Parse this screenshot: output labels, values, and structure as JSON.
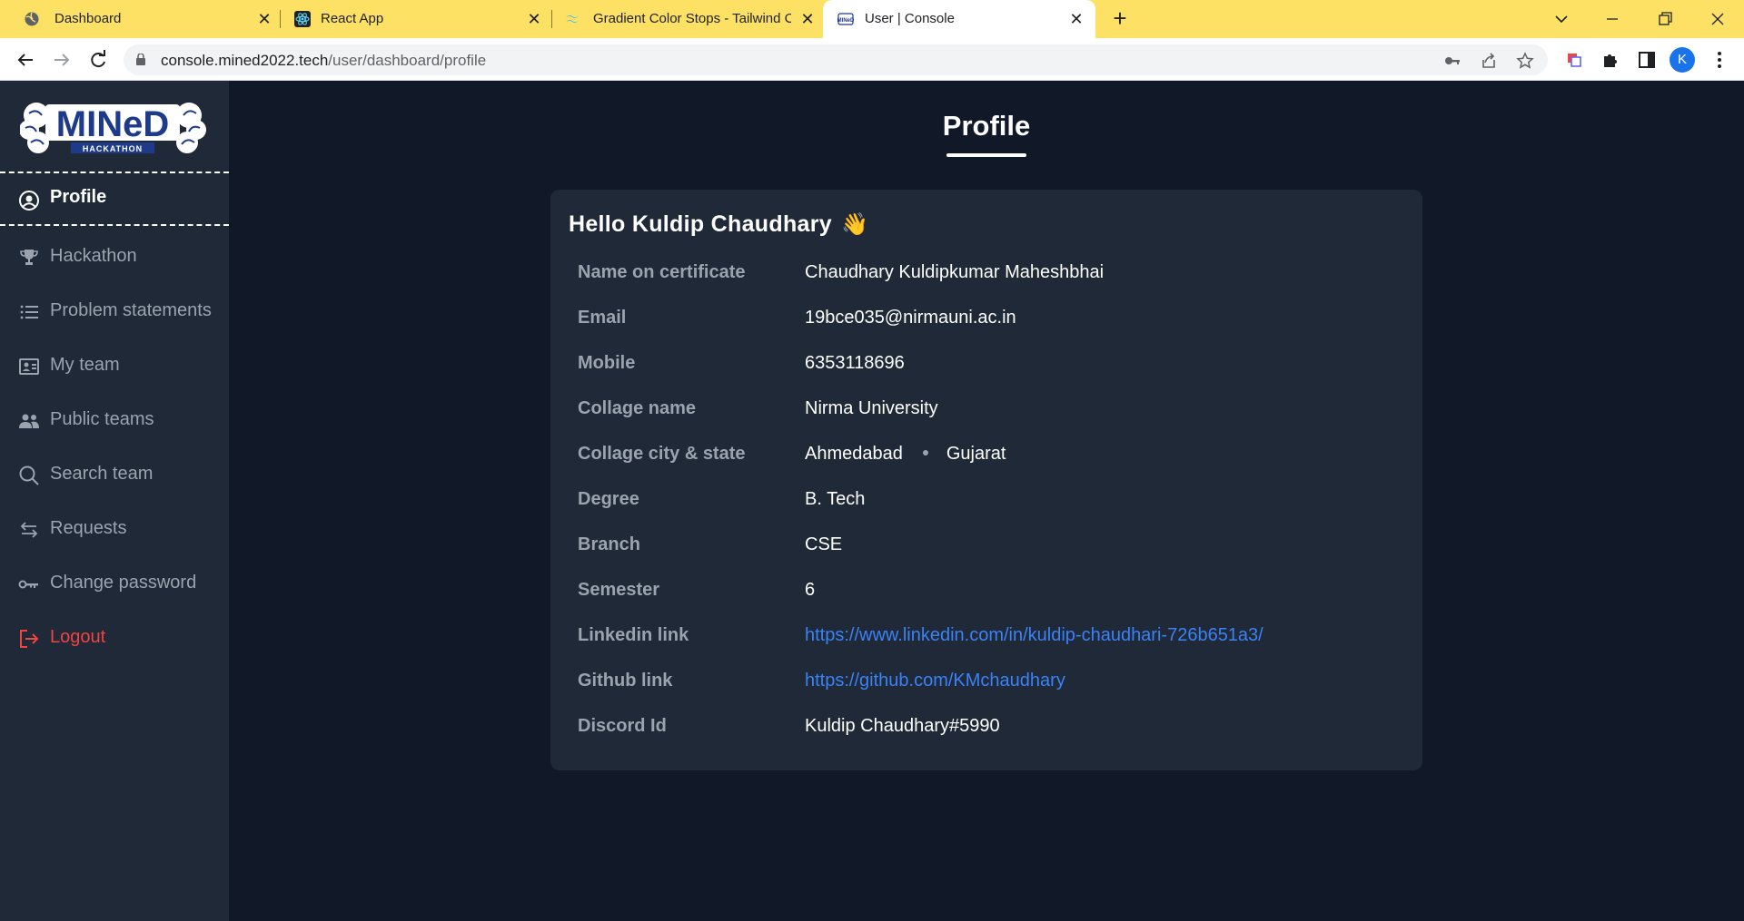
{
  "browser": {
    "tabs": [
      {
        "title": "Dashboard",
        "icon": "globe-icon"
      },
      {
        "title": "React App",
        "icon": "react-icon"
      },
      {
        "title": "Gradient Color Stops - Tailwind C",
        "icon": "tailwind-icon"
      },
      {
        "title": "User | Console",
        "icon": "mined-icon",
        "active": true
      }
    ],
    "url_host": "console.mined2022.tech",
    "url_path": "/user/dashboard/profile",
    "profile_initial": "K"
  },
  "sidebar": {
    "logo_alt": "MINeD HACKATHON",
    "logo_text": "MINeD",
    "logo_sub": "HACKATHON",
    "items": [
      {
        "label": "Profile",
        "icon": "user-circle-icon"
      },
      {
        "label": "Hackathon",
        "icon": "trophy-icon"
      },
      {
        "label": "Problem statements",
        "icon": "list-icon"
      },
      {
        "label": "My team",
        "icon": "id-card-icon"
      },
      {
        "label": "Public teams",
        "icon": "users-icon"
      },
      {
        "label": "Search team",
        "icon": "search-icon"
      },
      {
        "label": "Requests",
        "icon": "arrows-swap-icon"
      },
      {
        "label": "Change password",
        "icon": "key-icon"
      },
      {
        "label": "Logout",
        "icon": "logout-icon"
      }
    ]
  },
  "main": {
    "title": "Profile",
    "greeting": "Hello Kuldip Chaudhary",
    "greeting_emoji": "👋",
    "fields": [
      {
        "label": "Name on certificate",
        "value": "Chaudhary Kuldipkumar Maheshbhai"
      },
      {
        "label": "Email",
        "value": "19bce035@nirmauni.ac.in"
      },
      {
        "label": "Mobile",
        "value": "6353118696"
      },
      {
        "label": "Collage name",
        "value": "Nirma University"
      },
      {
        "label": "Collage city & state",
        "city": "Ahmedabad",
        "state": "Gujarat"
      },
      {
        "label": "Degree",
        "value": "B. Tech"
      },
      {
        "label": "Branch",
        "value": "CSE"
      },
      {
        "label": "Semester",
        "value": "6"
      },
      {
        "label": "Linkedin link",
        "value": "https://www.linkedin.com/in/kuldip-chaudhari-726b651a3/"
      },
      {
        "label": "Github link",
        "value": "https://github.com/KMchaudhary"
      },
      {
        "label": "Discord Id",
        "value": "Kuldip Chaudhary#5990"
      }
    ]
  },
  "colors": {
    "tab_strip": "#fde164",
    "sidebar_bg": "#1f2937",
    "main_bg": "#111827",
    "card_bg": "#1f2937",
    "link": "#3b82f6",
    "logout": "#ef4444"
  }
}
